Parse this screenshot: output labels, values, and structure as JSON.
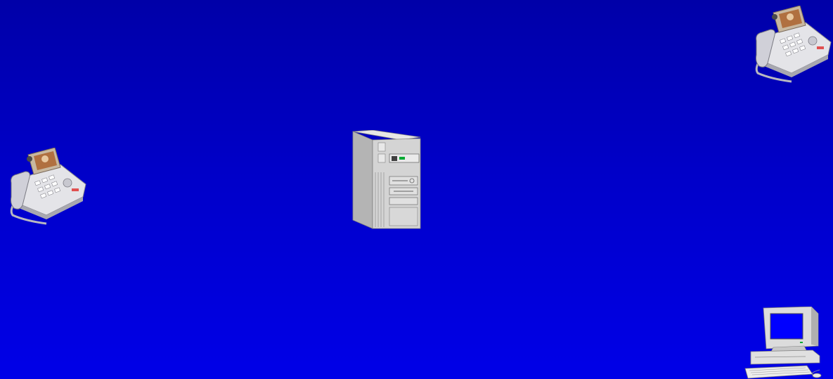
{
  "slide": {
    "background_top": "#0000a8",
    "background_bottom": "#0000e8"
  },
  "devices": [
    {
      "name": "video-phone-top-right",
      "icon": "video-phone-icon"
    },
    {
      "name": "video-phone-left",
      "icon": "video-phone-icon"
    },
    {
      "name": "server-tower",
      "icon": "server-tower-icon"
    },
    {
      "name": "desktop-computer",
      "icon": "desktop-computer-icon"
    }
  ],
  "colors": {
    "device_body": "#d8d8d8",
    "device_shadow": "#9a9a9a",
    "monitor_screen": "#0000ff",
    "phone_video_screen": "#b07040",
    "status_led": "#00aa33",
    "phone_accent": "#e05050"
  }
}
